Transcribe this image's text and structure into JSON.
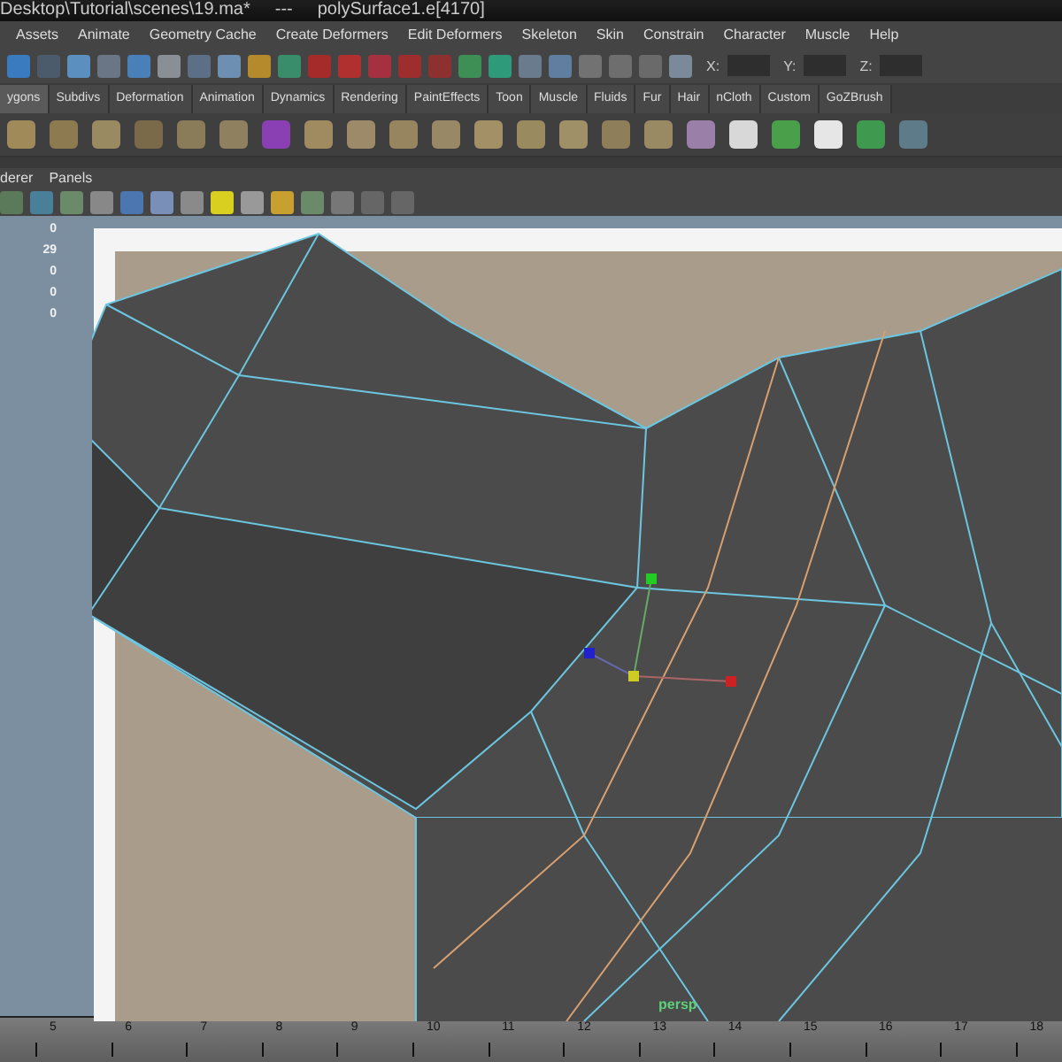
{
  "window": {
    "title": "Desktop\\Tutorial\\scenes\\19.ma*",
    "separator": "---",
    "selection": "polySurface1.e[4170]"
  },
  "menu_bar": [
    "Assets",
    "Animate",
    "Geometry Cache",
    "Create Deformers",
    "Edit Deformers",
    "Skeleton",
    "Skin",
    "Constrain",
    "Character",
    "Muscle",
    "Help"
  ],
  "coordinates": [
    {
      "label": "X:"
    },
    {
      "label": "Y:"
    },
    {
      "label": "Z:"
    }
  ],
  "shelf_tabs": [
    {
      "label": "ygons",
      "selected": true
    },
    {
      "label": "Subdivs",
      "selected": false
    },
    {
      "label": "Deformation",
      "selected": false
    },
    {
      "label": "Animation",
      "selected": false
    },
    {
      "label": "Dynamics",
      "selected": false
    },
    {
      "label": "Rendering",
      "selected": false
    },
    {
      "label": "PaintEffects",
      "selected": false
    },
    {
      "label": "Toon",
      "selected": false
    },
    {
      "label": "Muscle",
      "selected": false
    },
    {
      "label": "Fluids",
      "selected": false
    },
    {
      "label": "Fur",
      "selected": false
    },
    {
      "label": "Hair",
      "selected": false
    },
    {
      "label": "nCloth",
      "selected": false
    },
    {
      "label": "Custom",
      "selected": false
    },
    {
      "label": "GoZBrush",
      "selected": false
    }
  ],
  "panel_menu": [
    "derer",
    "Panels"
  ],
  "hud_values": [
    "0",
    "29",
    "0",
    "0",
    "0"
  ],
  "viewport": {
    "camera": "persp"
  },
  "time_slider": {
    "ticks": [
      "5",
      "6",
      "7",
      "8",
      "9",
      "10",
      "11",
      "12",
      "13",
      "14",
      "15",
      "16",
      "17",
      "18"
    ]
  }
}
